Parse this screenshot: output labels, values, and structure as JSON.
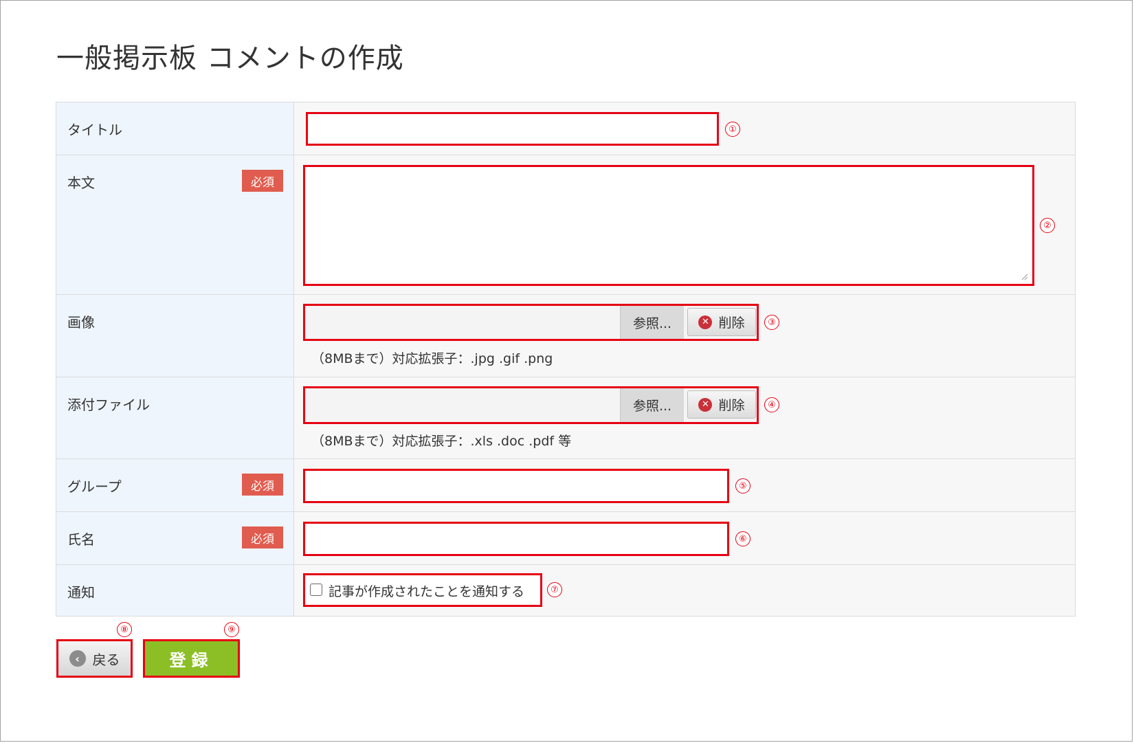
{
  "page": {
    "title": "一般掲示板 コメントの作成"
  },
  "required_label": "必須",
  "fields": {
    "title": {
      "label": "タイトル",
      "value": "",
      "marker": "①"
    },
    "body": {
      "label": "本文",
      "value": "",
      "marker": "②"
    },
    "image": {
      "label": "画像",
      "browse": "参照...",
      "delete": "削除",
      "note": "（8MBまで）対応拡張子：.jpg .gif .png",
      "marker": "③"
    },
    "attachment": {
      "label": "添付ファイル",
      "browse": "参照...",
      "delete": "削除",
      "note": "（8MBまで）対応拡張子：.xls .doc .pdf 等",
      "marker": "④"
    },
    "group": {
      "label": "グループ",
      "value": "",
      "marker": "⑤"
    },
    "name": {
      "label": "氏名",
      "value": "",
      "marker": "⑥"
    },
    "notify": {
      "label": "通知",
      "checkbox_label": "記事が作成されたことを通知する",
      "checked": false,
      "marker": "⑦"
    }
  },
  "buttons": {
    "back": {
      "label": "戻る",
      "marker": "⑧"
    },
    "submit": {
      "label": "登録",
      "marker": "⑨"
    }
  },
  "colors": {
    "accent_red": "#e60012",
    "required_badge": "#e05c4f",
    "submit_green": "#8cbf26",
    "label_bg": "#eef5fc"
  }
}
